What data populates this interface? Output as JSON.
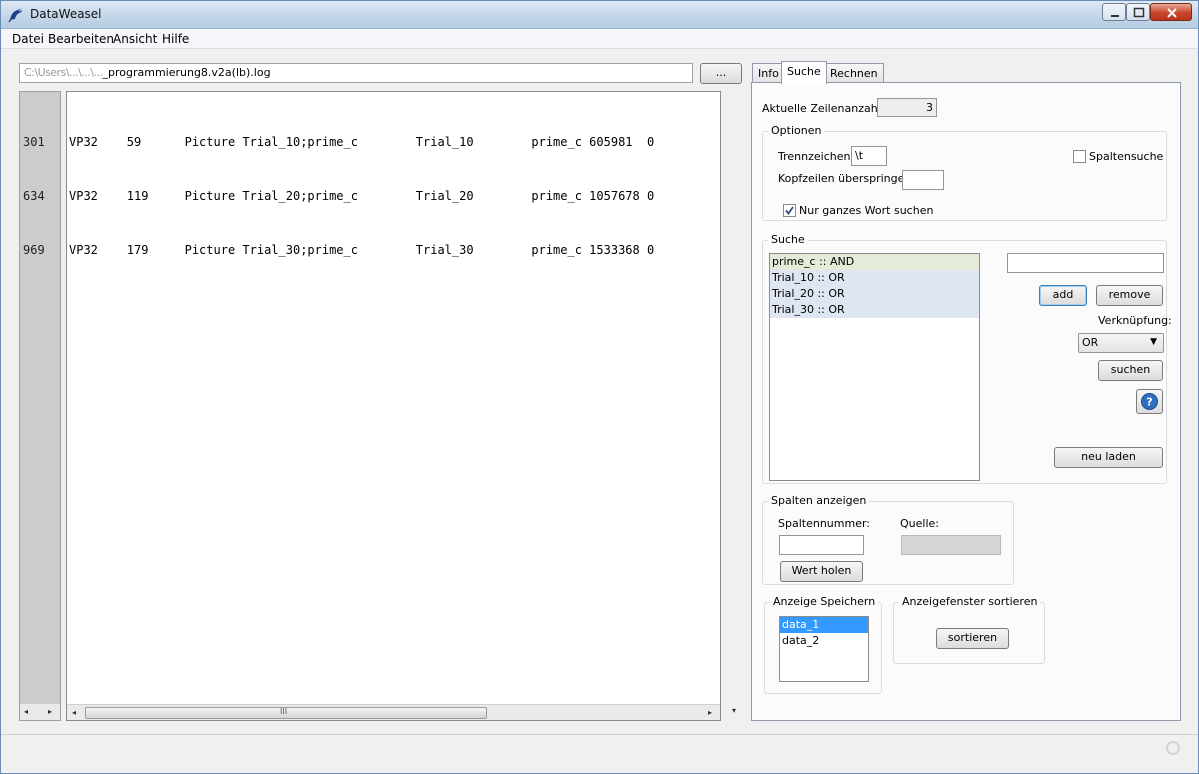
{
  "window": {
    "title": "DataWeasel"
  },
  "menu": [
    "Datei",
    "Bearbeiten",
    "Ansicht",
    "Hilfe"
  ],
  "file": {
    "path_blurred": "C:\\Users\\...\\...\\...",
    "path_visible": "_programmierung8.v2a(lb).log",
    "browse_label": "..."
  },
  "line_numbers": [
    "301",
    "634",
    "969"
  ],
  "rows": [
    "VP32    59      Picture Trial_10;prime_c        Trial_10        prime_c 605981  0",
    "VP32    119     Picture Trial_20;prime_c        Trial_20        prime_c 1057678 0",
    "VP32    179     Picture Trial_30;prime_c        Trial_30        prime_c 1533368 0"
  ],
  "scroll": {
    "thumb_glyph": "III"
  },
  "tabs": [
    {
      "label": "Info",
      "active": false
    },
    {
      "label": "Suche",
      "active": true
    },
    {
      "label": "Rechnen",
      "active": false
    }
  ],
  "search_tab": {
    "row_count_label": "Aktuelle Zeilenanzahl:",
    "row_count_value": "3",
    "options": {
      "title": "Optionen",
      "separator_label": "Trennzeichen:",
      "separator_value": "\\t",
      "column_search_label": "Spaltensuche",
      "column_search_checked": false,
      "skip_header_label": "Kopfzeilen überspringen:",
      "skip_header_value": "",
      "whole_word_label": "Nur ganzes Wort suchen",
      "whole_word_checked": true
    },
    "search": {
      "title": "Suche",
      "terms": [
        "prime_c :: AND",
        "Trial_10 :: OR",
        "Trial_20 :: OR",
        "Trial_30 :: OR"
      ],
      "term_input": "",
      "add_label": "add",
      "remove_label": "remove",
      "link_label": "Verknüpfung:",
      "link_value": "OR",
      "search_label": "suchen",
      "reload_label": "neu laden"
    },
    "columns": {
      "title": "Spalten anzeigen",
      "column_number_label": "Spaltennummer:",
      "source_label": "Quelle:",
      "column_number_value": "",
      "fetch_label": "Wert holen"
    },
    "save_display": {
      "title": "Anzeige Speichern",
      "items": [
        "data_1",
        "data_2"
      ],
      "selected": 0
    },
    "sort_display": {
      "title": "Anzeigefenster sortieren",
      "sort_label": "sortieren"
    }
  },
  "colors": {
    "selection": "#3399ff",
    "list_highlight_and": "#e4ecd9",
    "list_highlight_or": "#dde6f1"
  }
}
